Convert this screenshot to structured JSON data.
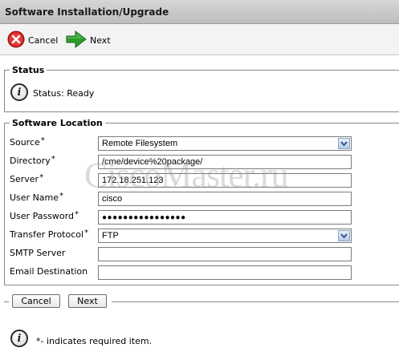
{
  "window": {
    "title": "Software Installation/Upgrade"
  },
  "toolbar": {
    "cancel_label": "Cancel",
    "next_label": "Next"
  },
  "status": {
    "legend": "Status",
    "text": "Status: Ready"
  },
  "software_location": {
    "legend": "Software Location",
    "fields": [
      {
        "label": "Source",
        "required": true,
        "type": "select",
        "value": "Remote Filesystem"
      },
      {
        "label": "Directory",
        "required": true,
        "type": "text",
        "value": "/cme/device%20package/"
      },
      {
        "label": "Server",
        "required": true,
        "type": "text",
        "value": "172.18.251.123"
      },
      {
        "label": "User Name",
        "required": true,
        "type": "text",
        "value": "cisco"
      },
      {
        "label": "User Password",
        "required": true,
        "type": "password",
        "value": "●●●●●●●●●●●●●●●●"
      },
      {
        "label": "Transfer Protocol",
        "required": true,
        "type": "select",
        "value": "FTP"
      },
      {
        "label": "SMTP Server",
        "required": false,
        "type": "text",
        "value": ""
      },
      {
        "label": "Email Destination",
        "required": false,
        "type": "text",
        "value": ""
      }
    ]
  },
  "required_mark": "*",
  "buttons": {
    "cancel": "Cancel",
    "next": "Next"
  },
  "footer": {
    "note": "*- indicates required item."
  },
  "watermark": "CiscoMaster.ru",
  "colors": {
    "cancel_icon": "#d62020",
    "next_arrow": "#2e9a2e",
    "select_arrow": "#2c4f86"
  }
}
